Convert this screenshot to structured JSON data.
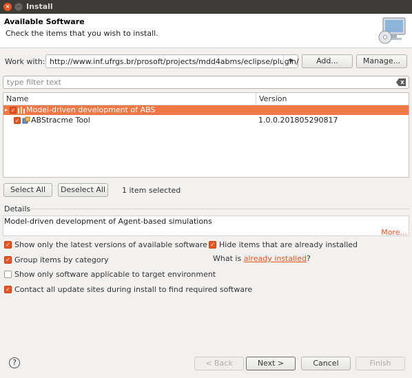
{
  "window": {
    "title": "Install",
    "close_glyph": "×",
    "min_glyph": "−"
  },
  "header": {
    "title": "Available Software",
    "subtitle": "Check the items that you wish to install."
  },
  "work_with": {
    "label": "Work with:",
    "value": "http://www.inf.ufrgs.br/prosoft/projects/mdd4abms/eclipse/plugin/",
    "add_label": "Add...",
    "manage_label": "Manage..."
  },
  "filter": {
    "placeholder": "type filter text"
  },
  "table": {
    "columns": [
      "Name",
      "Version"
    ],
    "rows": [
      {
        "name": "Model-driven development of ABS",
        "version": "",
        "checked": true,
        "selected": true,
        "expander": "▸"
      },
      {
        "name": "ABStracme Tool",
        "version": "1.0.0.201805290817",
        "checked": true,
        "selected": false
      }
    ]
  },
  "selection": {
    "select_all": "Select All",
    "deselect_all": "Deselect All",
    "status": "1 item selected"
  },
  "details": {
    "label": "Details",
    "text": "Model-driven development of Agent-based simulations",
    "more": "More..."
  },
  "options": {
    "latest_versions": {
      "label": "Show only the latest versions of available software",
      "checked": true
    },
    "hide_installed": {
      "label": "Hide items that are already installed",
      "checked": true
    },
    "group_by_category": {
      "label": "Group items by category",
      "checked": true
    },
    "whats_installed_prefix": "What is ",
    "whats_installed_link": "already installed",
    "whats_installed_suffix": "?",
    "target_env": {
      "label": "Show only software applicable to target environment",
      "checked": false
    },
    "contact_sites": {
      "label": "Contact all update sites during install to find required software",
      "checked": true
    }
  },
  "footer": {
    "help": "?",
    "back": "< Back",
    "next": "Next >",
    "cancel": "Cancel",
    "finish": "Finish"
  },
  "colors": {
    "accent": "#e95420",
    "selection": "#f07746",
    "titlebar": "#3c3b37"
  }
}
